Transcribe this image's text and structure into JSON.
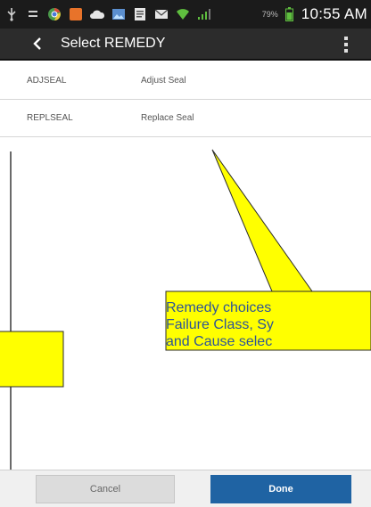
{
  "status_bar": {
    "time": "10:55 AM",
    "battery_percent": "79%",
    "icons": [
      "usb-icon",
      "menu-icon",
      "chrome-icon",
      "orange-app-icon",
      "cloud-icon",
      "photo-icon",
      "document-icon",
      "email-icon",
      "wifi-icon",
      "signal-icon",
      "battery-icon"
    ]
  },
  "action_bar": {
    "title": "Select REMEDY"
  },
  "list": {
    "rows": [
      {
        "code": "ADJSEAL",
        "description": "Adjust Seal"
      },
      {
        "code": "REPLSEAL",
        "description": "Replace Seal"
      }
    ]
  },
  "callout": {
    "lines": [
      "Remedy choices",
      "Failure Class, Sy",
      "and Cause selec"
    ],
    "fill_color": "#ffff00",
    "text_color": "#2e5597"
  },
  "buttons": {
    "cancel_label": "Cancel",
    "done_label": "Done"
  },
  "colors": {
    "done_button": "#1f63a3",
    "action_bar": "#2c2c2c",
    "status_bar": "#1b1b1b"
  }
}
